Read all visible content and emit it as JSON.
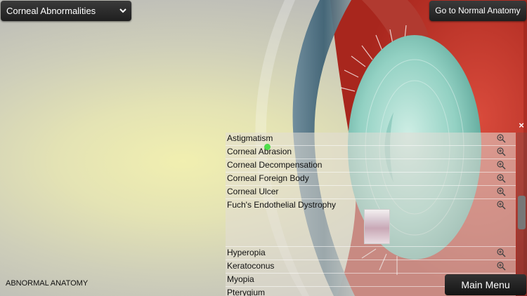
{
  "topbar": {
    "dropdown_label": "Corneal Abnormalities",
    "normal_anatomy_label": "Go to Normal Anatomy"
  },
  "panel": {
    "close_glyph": "×",
    "items": [
      {
        "label": "Astigmatism",
        "zoom": true
      },
      {
        "label": "Corneal Abrasion",
        "zoom": true
      },
      {
        "label": "Corneal Decompensation",
        "zoom": true
      },
      {
        "label": "Corneal Foreign Body",
        "zoom": true
      },
      {
        "label": "Corneal Ulcer",
        "zoom": true
      },
      {
        "label": "Fuch's Endothelial Dystrophy",
        "zoom": true
      },
      {
        "label": "Hyperopia",
        "zoom": true
      },
      {
        "label": "Keratoconus",
        "zoom": true
      },
      {
        "label": "Myopia",
        "zoom": false
      },
      {
        "label": "Pterygium",
        "zoom": false
      }
    ]
  },
  "footer": {
    "section_label": "ABNORMAL ANATOMY",
    "main_menu_label": "Main Menu"
  },
  "colors": {
    "accent": "#1f1f1f",
    "sclera": "#c0392b",
    "lens": "#8fd3c7"
  }
}
